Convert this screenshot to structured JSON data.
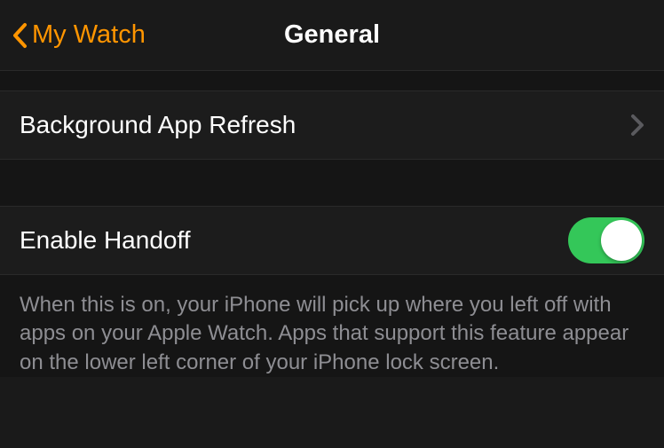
{
  "header": {
    "back_label": "My Watch",
    "title": "General"
  },
  "rows": {
    "background_app_refresh": {
      "label": "Background App Refresh"
    },
    "enable_handoff": {
      "label": "Enable Handoff",
      "enabled": true
    }
  },
  "footer": {
    "handoff_description": "When this is on, your iPhone will pick up where you left off with apps on your Apple Watch. Apps that support this feature appear on the lower left corner of your iPhone lock screen."
  },
  "colors": {
    "accent": "#ff9500",
    "toggle_on": "#34c759",
    "background": "#1a1a1a",
    "text_secondary": "#8e8e93"
  }
}
